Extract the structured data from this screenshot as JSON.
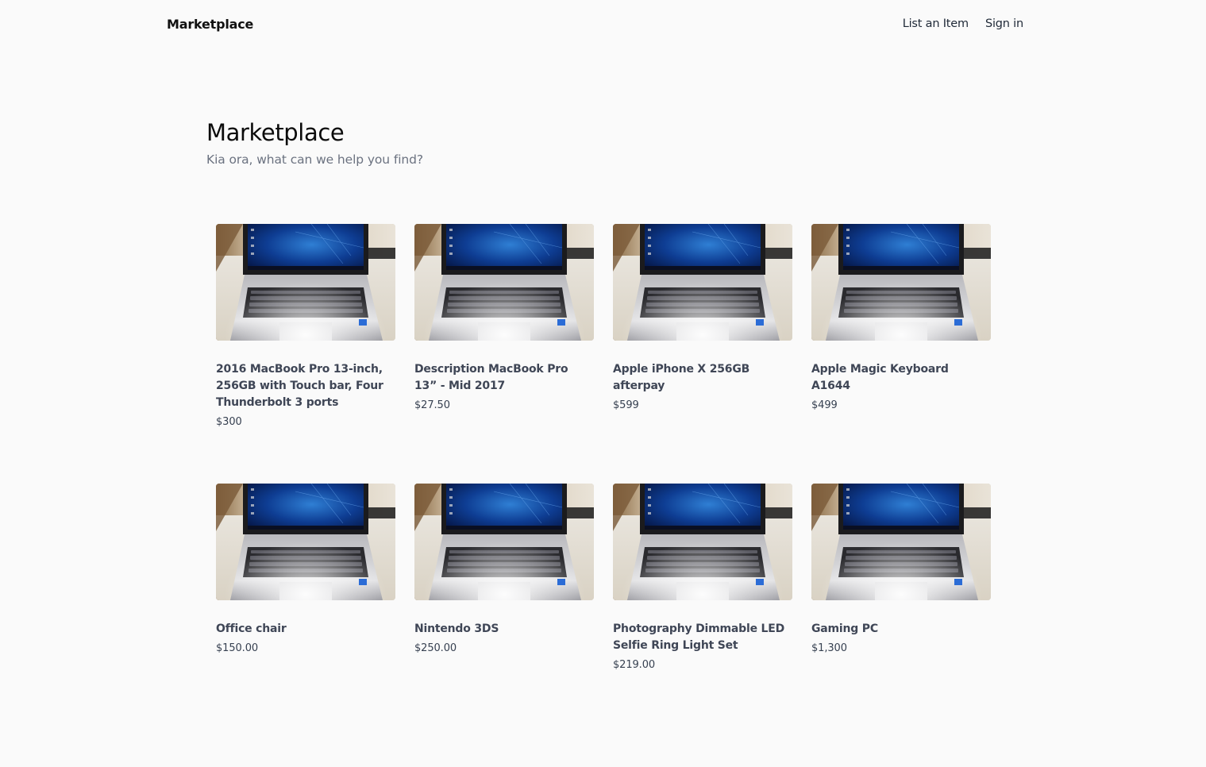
{
  "header": {
    "brand": "Marketplace",
    "nav": [
      {
        "label": "List an Item"
      },
      {
        "label": "Sign in"
      }
    ]
  },
  "hero": {
    "title": "Marketplace",
    "subtitle": "Kia ora, what can we help you find?"
  },
  "listings": [
    {
      "title": "2016 MacBook Pro 13-inch, 256GB with Touch bar, Four Thunderbolt 3 ports",
      "price": "$300"
    },
    {
      "title": "Description MacBook Pro 13” - Mid 2017",
      "price": "$27.50"
    },
    {
      "title": "Apple iPhone X 256GB afterpay",
      "price": "$599"
    },
    {
      "title": "Apple Magic Keyboard A1644",
      "price": "$499"
    },
    {
      "title": "Office chair",
      "price": "$150.00"
    },
    {
      "title": "Nintendo 3DS",
      "price": "$250.00"
    },
    {
      "title": "Photography Dimmable LED Selfie Ring Light Set",
      "price": "$219.00"
    },
    {
      "title": "Gaming PC",
      "price": "$1,300"
    }
  ]
}
